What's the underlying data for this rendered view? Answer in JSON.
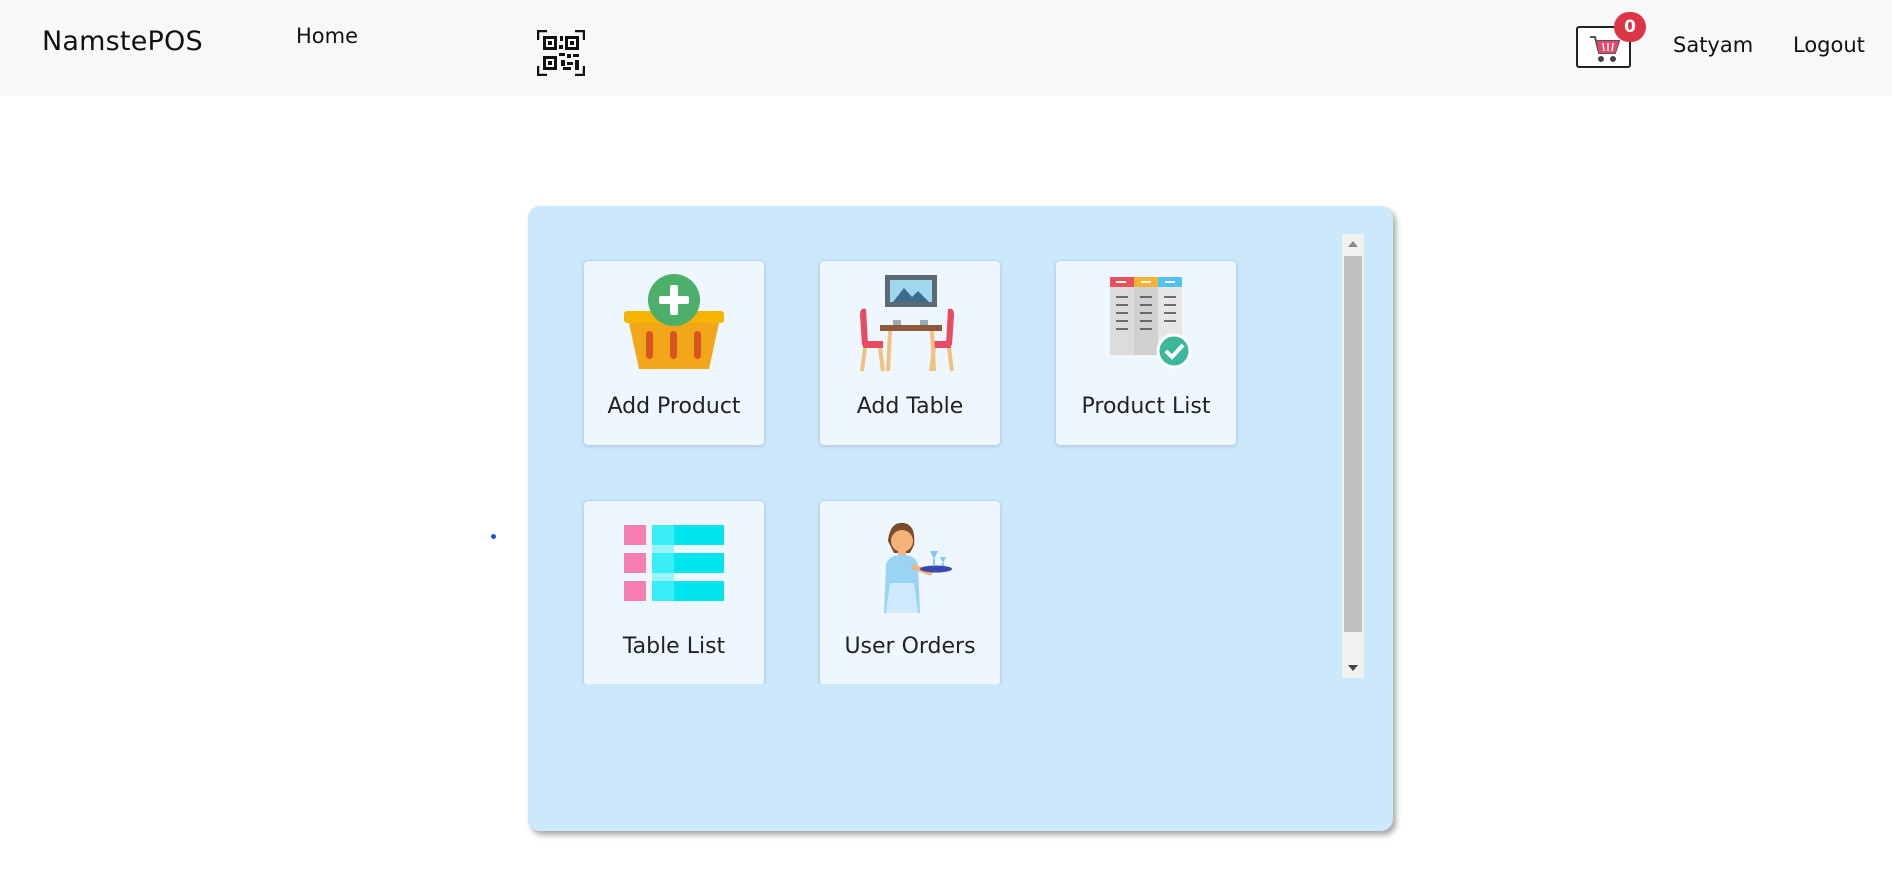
{
  "navbar": {
    "brand": "NamstePOS",
    "home_label": "Home",
    "qr_icon": "qr-code-icon",
    "cart_icon": "shopping-cart-icon",
    "cart_count": "0",
    "user_name": "Satyam",
    "logout_label": "Logout"
  },
  "dashboard": {
    "tiles": [
      {
        "label": "Add Product",
        "icon": "basket-add-icon"
      },
      {
        "label": "Add Table",
        "icon": "dining-table-icon"
      },
      {
        "label": "Product List",
        "icon": "menu-list-icon"
      },
      {
        "label": "Table List",
        "icon": "table-list-icon"
      },
      {
        "label": "User Orders",
        "icon": "waitress-icon"
      }
    ]
  },
  "colors": {
    "panel_bg": "#cce8fb",
    "tile_bg": "#eef6ff",
    "badge": "#dc3545",
    "navbar_bg": "#f7f8fa"
  }
}
